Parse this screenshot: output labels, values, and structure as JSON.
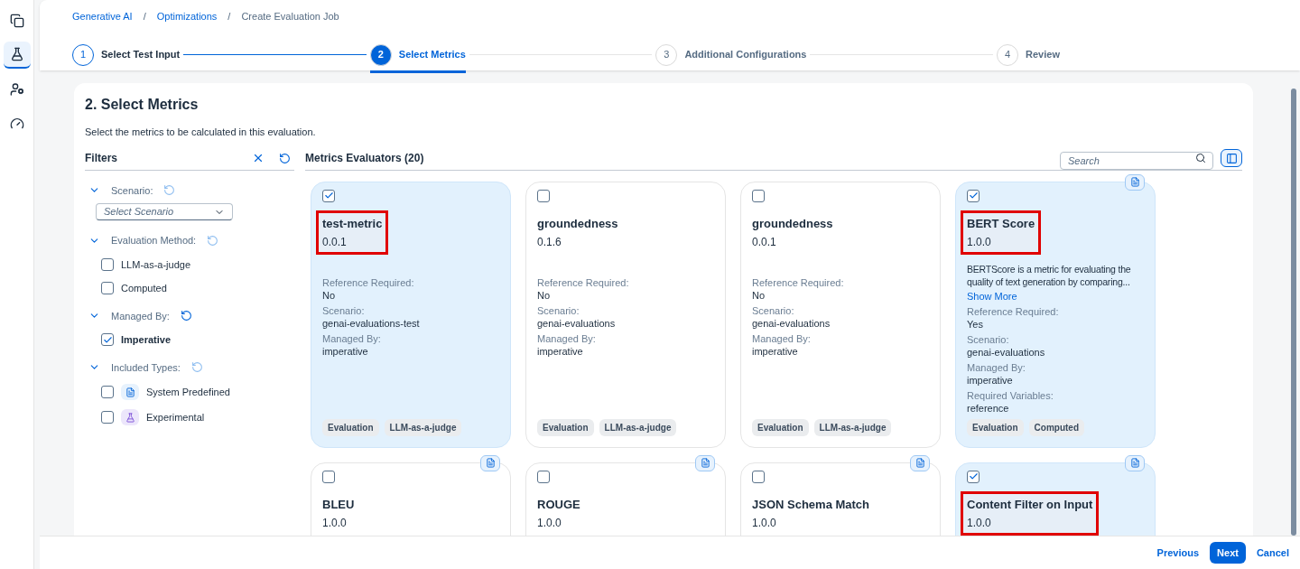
{
  "rail": [
    {
      "kind": "copy",
      "selected": false
    },
    {
      "kind": "flask",
      "selected": true
    },
    {
      "kind": "user-gear",
      "selected": false
    },
    {
      "kind": "gauge",
      "selected": false
    }
  ],
  "breadcrumb": [
    {
      "label": "Generative AI",
      "link": true
    },
    {
      "separator": "/",
      "label": "Optimizations",
      "link": true
    },
    {
      "separator": "/",
      "label": "Create Evaluation Job",
      "link": false
    }
  ],
  "steps": [
    {
      "number": "1",
      "label": "Select Test Input",
      "selected": false,
      "completed": true
    },
    {
      "number": "2",
      "label": "Select Metrics",
      "selected": true,
      "completed": false
    },
    {
      "number": "3",
      "label": "Additional Configurations",
      "selected": false,
      "completed": false
    },
    {
      "number": "4",
      "label": "Review",
      "selected": false,
      "completed": false
    }
  ],
  "page": {
    "title": "2. Select Metrics",
    "subtitle": "Select the metrics to be calculated in this evaluation."
  },
  "filters": {
    "title": "Filters",
    "groups": [
      {
        "label": "Scenario:",
        "expanded": true,
        "reset_active": false,
        "kind": "select",
        "placeholder": "Select Scenario"
      },
      {
        "label": "Evaluation Method:",
        "expanded": true,
        "reset_active": false,
        "kind": "checks",
        "options": [
          {
            "label": "LLM-as-a-judge",
            "checked": false
          },
          {
            "label": "Computed",
            "checked": false
          }
        ]
      },
      {
        "label": "Managed By:",
        "expanded": true,
        "reset_active": true,
        "kind": "checks",
        "options": [
          {
            "label": "Imperative",
            "checked": true
          }
        ]
      },
      {
        "label": "Included Types:",
        "expanded": true,
        "reset_active": false,
        "kind": "checks",
        "options": [
          {
            "label": "System Predefined",
            "checked": false,
            "kind": "predefined"
          },
          {
            "label": "Experimental",
            "checked": false,
            "kind": "experimental"
          }
        ]
      }
    ]
  },
  "evaluators": {
    "title": "Metrics Evaluators (20)",
    "search_placeholder": "Search",
    "cards": [
      {
        "name": "test-metric",
        "version": "0.0.1",
        "checked": true,
        "highlighted": true,
        "predefined": false,
        "fields": [
          {
            "label": "Reference Required:",
            "value": "No"
          },
          {
            "label": "Scenario:",
            "value": "genai-evaluations-test"
          },
          {
            "label": "Managed By:",
            "value": "imperative"
          }
        ],
        "tags": [
          "Evaluation",
          "LLM-as-a-judge"
        ]
      },
      {
        "name": "groundedness",
        "version": "0.1.6",
        "checked": false,
        "highlighted": false,
        "predefined": false,
        "fields": [
          {
            "label": "Reference Required:",
            "value": "No"
          },
          {
            "label": "Scenario:",
            "value": "genai-evaluations"
          },
          {
            "label": "Managed By:",
            "value": "imperative"
          }
        ],
        "tags": [
          "Evaluation",
          "LLM-as-a-judge"
        ]
      },
      {
        "name": "groundedness",
        "version": "0.0.1",
        "checked": false,
        "highlighted": false,
        "predefined": false,
        "fields": [
          {
            "label": "Reference Required:",
            "value": "No"
          },
          {
            "label": "Scenario:",
            "value": "genai-evaluations"
          },
          {
            "label": "Managed By:",
            "value": "imperative"
          }
        ],
        "tags": [
          "Evaluation",
          "LLM-as-a-judge"
        ]
      },
      {
        "name": "BERT Score",
        "version": "1.0.0",
        "checked": true,
        "highlighted": true,
        "predefined": true,
        "description": "BERTScore is a metric for evaluating the quality of text generation by comparing...",
        "more": "Show More",
        "fields": [
          {
            "label": "Reference Required:",
            "value": "Yes"
          },
          {
            "label": "Scenario:",
            "value": "genai-evaluations"
          },
          {
            "label": "Managed By:",
            "value": "imperative"
          },
          {
            "label": "Required Variables:",
            "value": "reference"
          }
        ],
        "tags": [
          "Evaluation",
          "Computed"
        ]
      },
      {
        "name": "BLEU",
        "version": "1.0.0",
        "checked": false,
        "highlighted": false,
        "predefined": true
      },
      {
        "name": "ROUGE",
        "version": "1.0.0",
        "checked": false,
        "highlighted": false,
        "predefined": true
      },
      {
        "name": "JSON Schema Match",
        "version": "1.0.0",
        "checked": false,
        "highlighted": false,
        "predefined": true
      },
      {
        "name": "Content Filter on Input",
        "version": "1.0.0",
        "checked": true,
        "highlighted": true,
        "predefined": true
      }
    ]
  },
  "footer": [
    {
      "label": "Previous",
      "kind": "link"
    },
    {
      "label": "Next",
      "kind": "primary"
    },
    {
      "label": "Cancel",
      "kind": "link"
    }
  ]
}
